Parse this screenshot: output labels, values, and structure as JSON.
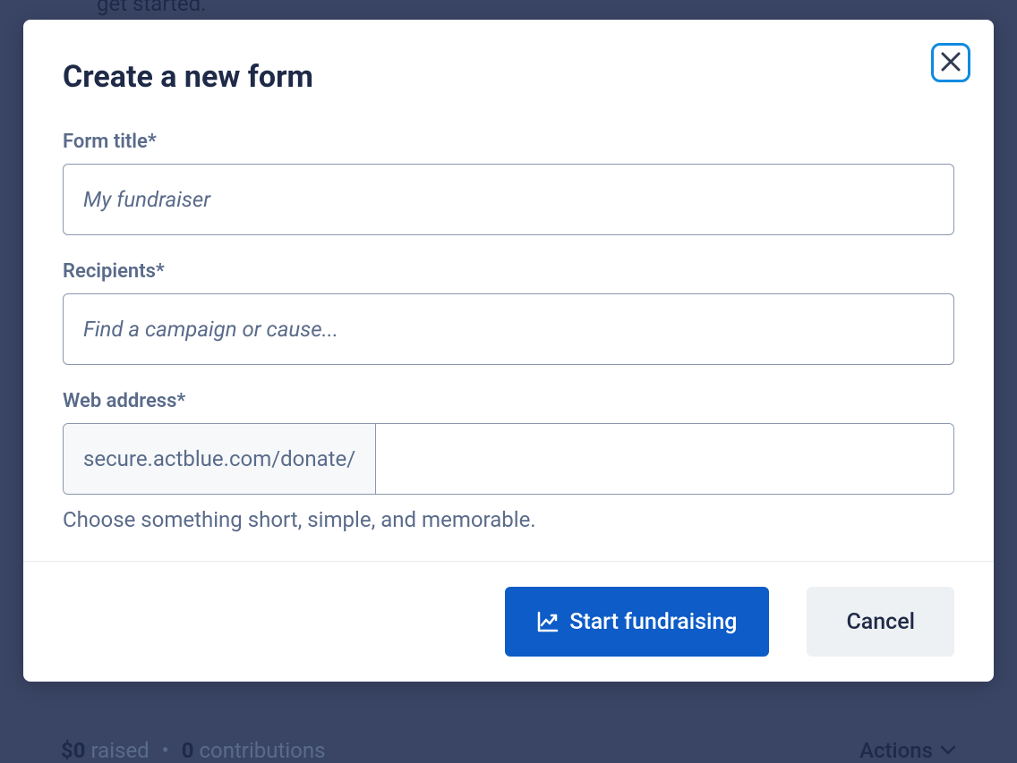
{
  "background": {
    "top_text": "get started.",
    "amount": "$0",
    "raised_label": "raised",
    "bullet": "•",
    "count": "0",
    "contributions_label": "contributions",
    "actions_label": "Actions"
  },
  "modal": {
    "title": "Create a new form",
    "fields": {
      "form_title": {
        "label": "Form title*",
        "placeholder": "My fundraiser",
        "value": ""
      },
      "recipients": {
        "label": "Recipients*",
        "placeholder": "Find a campaign or cause...",
        "value": ""
      },
      "web_address": {
        "label": "Web address*",
        "prefix": "secure.actblue.com/donate/",
        "value": "",
        "helper": "Choose something short, simple, and memorable."
      }
    },
    "buttons": {
      "submit": "Start fundraising",
      "cancel": "Cancel"
    }
  }
}
